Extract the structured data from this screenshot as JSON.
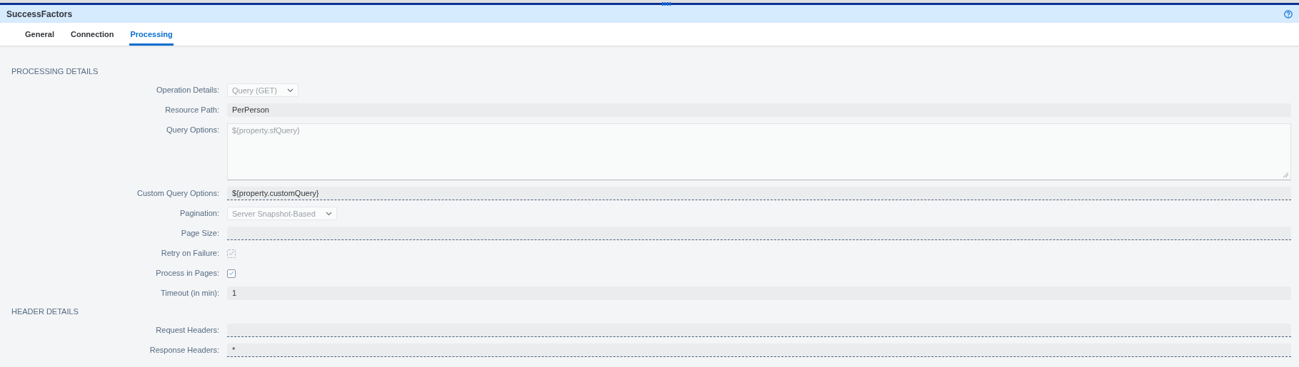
{
  "window": {
    "title": "SuccessFactors"
  },
  "tabs": [
    {
      "label": "General",
      "selected": false
    },
    {
      "label": "Connection",
      "selected": false
    },
    {
      "label": "Processing",
      "selected": true
    }
  ],
  "sections": [
    {
      "title": "PROCESSING DETAILS",
      "fields": [
        {
          "kind": "select",
          "label": "Operation Details:",
          "value": "Query (GET)",
          "disabled": true
        },
        {
          "kind": "text",
          "label": "Resource Path:",
          "value": "PerPerson",
          "editable": false
        },
        {
          "kind": "textarea",
          "label": "Query Options:",
          "value": "${property.sfQuery}",
          "disabled": true
        },
        {
          "kind": "text",
          "label": "Custom Query Options:",
          "value": "${property.customQuery}",
          "editable": true
        },
        {
          "kind": "select",
          "label": "Pagination:",
          "value": "Server Snapshot-Based",
          "disabled": true
        },
        {
          "kind": "text",
          "label": "Page Size:",
          "editable": true
        },
        {
          "kind": "checkbox",
          "label": "Retry on Failure:",
          "checked": true,
          "disabled": true
        },
        {
          "kind": "checkbox",
          "label": "Process in Pages:",
          "checked": true,
          "disabled": false
        },
        {
          "kind": "text",
          "label": "Timeout (in min):",
          "value": "1",
          "editable": false
        }
      ]
    },
    {
      "title": "HEADER DETAILS",
      "fields": [
        {
          "kind": "text",
          "label": "Request Headers:",
          "editable": true
        },
        {
          "kind": "text",
          "label": "Response Headers:",
          "value": "*",
          "editable": true
        }
      ]
    }
  ]
}
